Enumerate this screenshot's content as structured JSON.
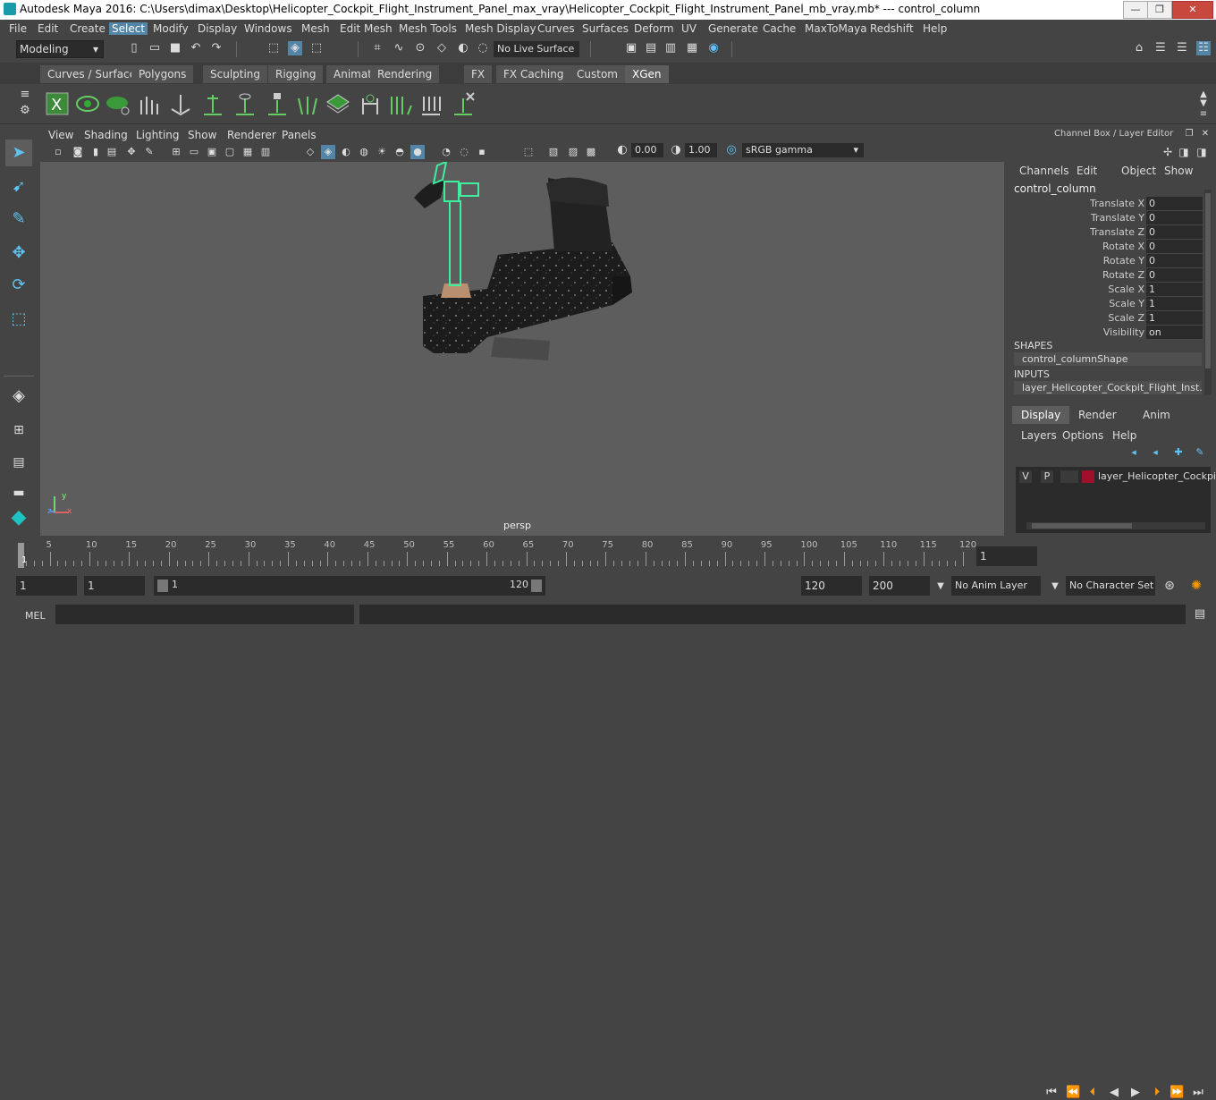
{
  "title": "Autodesk Maya 2016: C:\\Users\\dimax\\Desktop\\Helicopter_Cockpit_Flight_Instrument_Panel_max_vray\\Helicopter_Cockpit_Flight_Instrument_Panel_mb_vray.mb*   ---   control_column",
  "window_buttons": {
    "minimize": "—",
    "maximize": "❐",
    "close": "✕"
  },
  "menubar": [
    "File",
    "Edit",
    "Create",
    "Select",
    "Modify",
    "Display",
    "Windows",
    "Mesh",
    "Edit Mesh",
    "Mesh Tools",
    "Mesh Display",
    "Curves",
    "Surfaces",
    "Deform",
    "UV",
    "Generate",
    "Cache",
    "MaxToMaya",
    "Redshift",
    "Help"
  ],
  "menubar_selected": "Select",
  "status": {
    "mode": "Modeling",
    "live_surface": "No Live Surface"
  },
  "shelf_tabs": [
    "Curves / Surfaces",
    "Polygons",
    "Sculpting",
    "Rigging",
    "Animation",
    "Rendering",
    "FX",
    "FX Caching",
    "Custom",
    "XGen"
  ],
  "shelf_active": "XGen",
  "viewport": {
    "menus": [
      "View",
      "Shading",
      "Lighting",
      "Show",
      "Renderer",
      "Panels"
    ],
    "exposure": "0.00",
    "gamma": "1.00",
    "color_space": "sRGB gamma",
    "camera_label": "persp",
    "axis": {
      "x": "x",
      "y": "y",
      "z": "z"
    }
  },
  "channel_box": {
    "header": "Channel Box / Layer Editor",
    "menus": [
      "Channels",
      "Edit",
      "Object",
      "Show"
    ],
    "object_name": "control_column",
    "attributes": [
      {
        "label": "Translate X",
        "value": "0"
      },
      {
        "label": "Translate Y",
        "value": "0"
      },
      {
        "label": "Translate Z",
        "value": "0"
      },
      {
        "label": "Rotate X",
        "value": "0"
      },
      {
        "label": "Rotate Y",
        "value": "0"
      },
      {
        "label": "Rotate Z",
        "value": "0"
      },
      {
        "label": "Scale X",
        "value": "1"
      },
      {
        "label": "Scale Y",
        "value": "1"
      },
      {
        "label": "Scale Z",
        "value": "1"
      },
      {
        "label": "Visibility",
        "value": "on"
      }
    ],
    "shapes_header": "SHAPES",
    "shape_name": "control_columnShape",
    "inputs_header": "INPUTS",
    "input_name": "layer_Helicopter_Cockpit_Flight_Inst..."
  },
  "layer_editor": {
    "tabs": [
      "Display",
      "Render",
      "Anim"
    ],
    "active_tab": "Display",
    "menus": [
      "Layers",
      "Options",
      "Help"
    ],
    "layer": {
      "v": "V",
      "p": "P",
      "name": "layer_Helicopter_Cockpit",
      "color": "#a0102a"
    }
  },
  "timeline": {
    "ticks": [
      "5",
      "10",
      "15",
      "20",
      "25",
      "30",
      "35",
      "40",
      "45",
      "50",
      "55",
      "60",
      "65",
      "70",
      "75",
      "80",
      "85",
      "90",
      "95",
      "100",
      "105",
      "110",
      "115",
      "120"
    ],
    "current_marker": "1",
    "current_frame": "1"
  },
  "range": {
    "start": "1",
    "playback_start": "1",
    "slider_start": "1",
    "slider_end": "120",
    "playback_end": "120",
    "end": "200",
    "anim_layer": "No Anim Layer",
    "character_set": "No Character Set"
  },
  "command_line": {
    "label": "MEL"
  },
  "colors": {
    "accent": "#5285a6",
    "selection_green": "#3cf0a0",
    "layer_color": "#a0102a"
  }
}
